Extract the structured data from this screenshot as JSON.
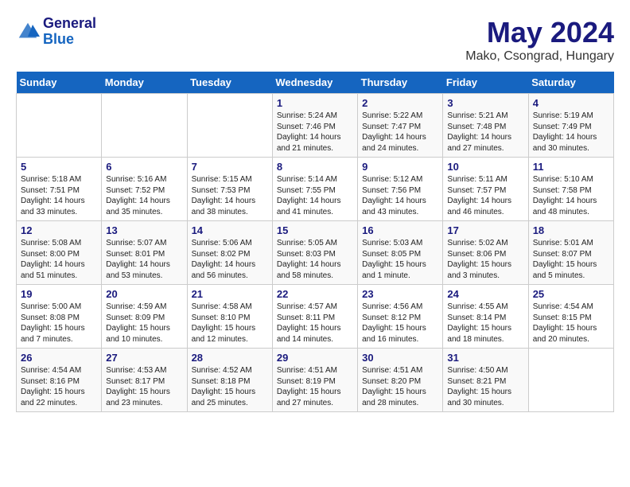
{
  "logo": {
    "line1": "General",
    "line2": "Blue"
  },
  "title": "May 2024",
  "location": "Mako, Csongrad, Hungary",
  "weekdays": [
    "Sunday",
    "Monday",
    "Tuesday",
    "Wednesday",
    "Thursday",
    "Friday",
    "Saturday"
  ],
  "weeks": [
    [
      {
        "day": null
      },
      {
        "day": null
      },
      {
        "day": null
      },
      {
        "day": "1",
        "sunrise": "5:24 AM",
        "sunset": "7:46 PM",
        "daylight": "14 hours and 21 minutes."
      },
      {
        "day": "2",
        "sunrise": "5:22 AM",
        "sunset": "7:47 PM",
        "daylight": "14 hours and 24 minutes."
      },
      {
        "day": "3",
        "sunrise": "5:21 AM",
        "sunset": "7:48 PM",
        "daylight": "14 hours and 27 minutes."
      },
      {
        "day": "4",
        "sunrise": "5:19 AM",
        "sunset": "7:49 PM",
        "daylight": "14 hours and 30 minutes."
      }
    ],
    [
      {
        "day": "5",
        "sunrise": "5:18 AM",
        "sunset": "7:51 PM",
        "daylight": "14 hours and 33 minutes."
      },
      {
        "day": "6",
        "sunrise": "5:16 AM",
        "sunset": "7:52 PM",
        "daylight": "14 hours and 35 minutes."
      },
      {
        "day": "7",
        "sunrise": "5:15 AM",
        "sunset": "7:53 PM",
        "daylight": "14 hours and 38 minutes."
      },
      {
        "day": "8",
        "sunrise": "5:14 AM",
        "sunset": "7:55 PM",
        "daylight": "14 hours and 41 minutes."
      },
      {
        "day": "9",
        "sunrise": "5:12 AM",
        "sunset": "7:56 PM",
        "daylight": "14 hours and 43 minutes."
      },
      {
        "day": "10",
        "sunrise": "5:11 AM",
        "sunset": "7:57 PM",
        "daylight": "14 hours and 46 minutes."
      },
      {
        "day": "11",
        "sunrise": "5:10 AM",
        "sunset": "7:58 PM",
        "daylight": "14 hours and 48 minutes."
      }
    ],
    [
      {
        "day": "12",
        "sunrise": "5:08 AM",
        "sunset": "8:00 PM",
        "daylight": "14 hours and 51 minutes."
      },
      {
        "day": "13",
        "sunrise": "5:07 AM",
        "sunset": "8:01 PM",
        "daylight": "14 hours and 53 minutes."
      },
      {
        "day": "14",
        "sunrise": "5:06 AM",
        "sunset": "8:02 PM",
        "daylight": "14 hours and 56 minutes."
      },
      {
        "day": "15",
        "sunrise": "5:05 AM",
        "sunset": "8:03 PM",
        "daylight": "14 hours and 58 minutes."
      },
      {
        "day": "16",
        "sunrise": "5:03 AM",
        "sunset": "8:05 PM",
        "daylight": "15 hours and 1 minute."
      },
      {
        "day": "17",
        "sunrise": "5:02 AM",
        "sunset": "8:06 PM",
        "daylight": "15 hours and 3 minutes."
      },
      {
        "day": "18",
        "sunrise": "5:01 AM",
        "sunset": "8:07 PM",
        "daylight": "15 hours and 5 minutes."
      }
    ],
    [
      {
        "day": "19",
        "sunrise": "5:00 AM",
        "sunset": "8:08 PM",
        "daylight": "15 hours and 7 minutes."
      },
      {
        "day": "20",
        "sunrise": "4:59 AM",
        "sunset": "8:09 PM",
        "daylight": "15 hours and 10 minutes."
      },
      {
        "day": "21",
        "sunrise": "4:58 AM",
        "sunset": "8:10 PM",
        "daylight": "15 hours and 12 minutes."
      },
      {
        "day": "22",
        "sunrise": "4:57 AM",
        "sunset": "8:11 PM",
        "daylight": "15 hours and 14 minutes."
      },
      {
        "day": "23",
        "sunrise": "4:56 AM",
        "sunset": "8:12 PM",
        "daylight": "15 hours and 16 minutes."
      },
      {
        "day": "24",
        "sunrise": "4:55 AM",
        "sunset": "8:14 PM",
        "daylight": "15 hours and 18 minutes."
      },
      {
        "day": "25",
        "sunrise": "4:54 AM",
        "sunset": "8:15 PM",
        "daylight": "15 hours and 20 minutes."
      }
    ],
    [
      {
        "day": "26",
        "sunrise": "4:54 AM",
        "sunset": "8:16 PM",
        "daylight": "15 hours and 22 minutes."
      },
      {
        "day": "27",
        "sunrise": "4:53 AM",
        "sunset": "8:17 PM",
        "daylight": "15 hours and 23 minutes."
      },
      {
        "day": "28",
        "sunrise": "4:52 AM",
        "sunset": "8:18 PM",
        "daylight": "15 hours and 25 minutes."
      },
      {
        "day": "29",
        "sunrise": "4:51 AM",
        "sunset": "8:19 PM",
        "daylight": "15 hours and 27 minutes."
      },
      {
        "day": "30",
        "sunrise": "4:51 AM",
        "sunset": "8:20 PM",
        "daylight": "15 hours and 28 minutes."
      },
      {
        "day": "31",
        "sunrise": "4:50 AM",
        "sunset": "8:21 PM",
        "daylight": "15 hours and 30 minutes."
      },
      {
        "day": null
      }
    ]
  ]
}
